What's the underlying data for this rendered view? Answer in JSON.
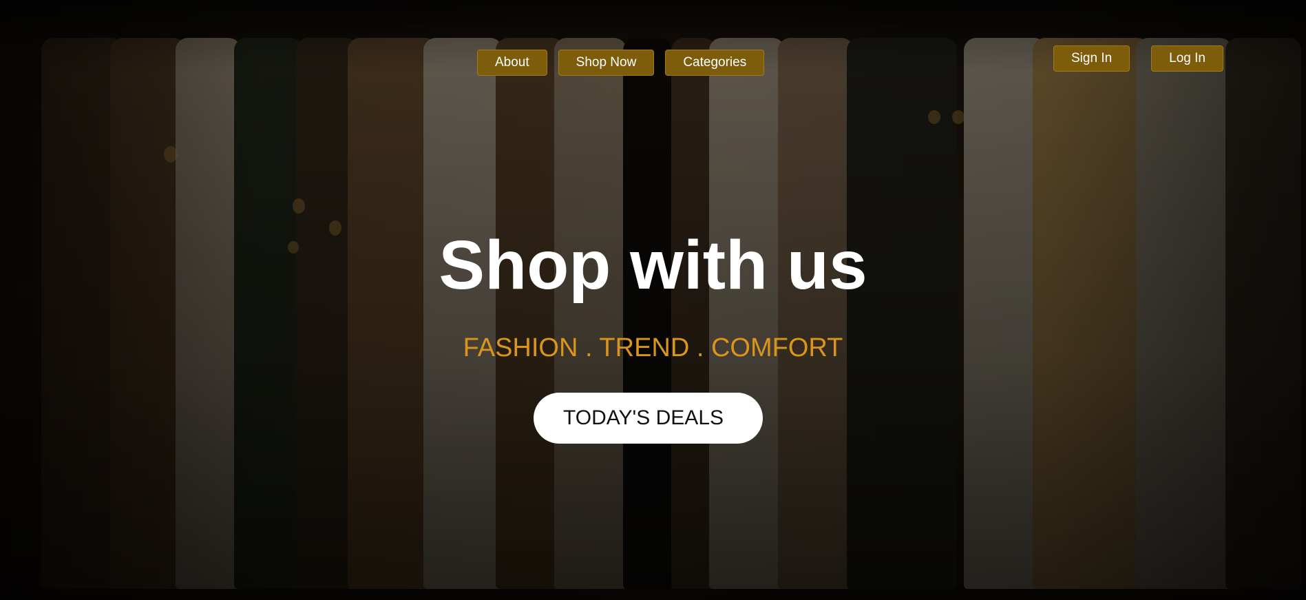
{
  "nav": {
    "items": [
      {
        "label": "About"
      },
      {
        "label": "Shop Now"
      },
      {
        "label": "Categories"
      }
    ]
  },
  "auth": {
    "sign_in_label": "Sign In",
    "log_in_label": "Log In"
  },
  "hero": {
    "title": "Shop with us",
    "tagline": "FASHION . TREND . COMFORT",
    "cta_label": "TODAY'S DEALS",
    "background_image": "clothing-rack-photo"
  },
  "colors": {
    "button_bg": "#7d5c0b",
    "button_text": "#ffffff",
    "title": "#ffffff",
    "tagline": "#d9961a",
    "cta_bg": "#ffffff",
    "cta_text": "#111111"
  }
}
